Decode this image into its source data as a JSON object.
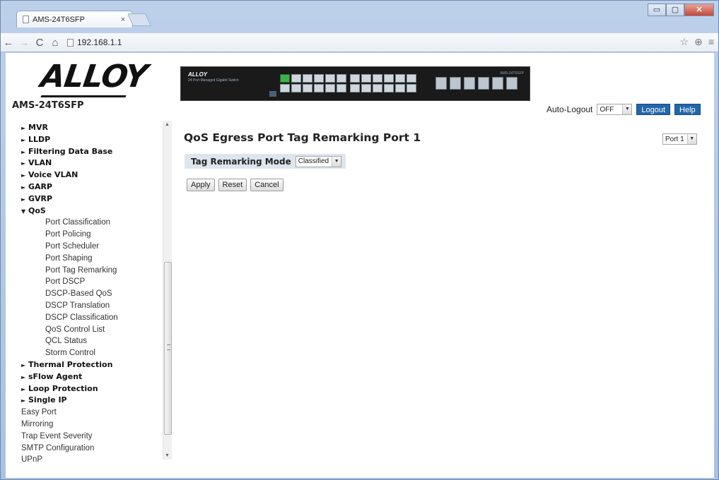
{
  "browser": {
    "tab_title": "AMS-24T6SFP",
    "tab_close": "×",
    "url": "192.168.1.1",
    "back": "←",
    "forward": "→",
    "reload": "C",
    "home": "⌂",
    "star": "☆",
    "ext": "⊕",
    "menu": "≡",
    "minimize": "▭",
    "maximize": "▢",
    "close": "✕"
  },
  "sidebar": {
    "logo": "ALLOY",
    "model": "AMS-24T6SFP",
    "items": [
      {
        "type": "group",
        "arrow": "►",
        "label": "MVR"
      },
      {
        "type": "group",
        "arrow": "►",
        "label": "LLDP"
      },
      {
        "type": "group",
        "arrow": "►",
        "label": "Filtering Data Base"
      },
      {
        "type": "group",
        "arrow": "►",
        "label": "VLAN"
      },
      {
        "type": "group",
        "arrow": "►",
        "label": "Voice VLAN"
      },
      {
        "type": "group",
        "arrow": "►",
        "label": "GARP"
      },
      {
        "type": "group",
        "arrow": "►",
        "label": "GVRP"
      },
      {
        "type": "group",
        "arrow": "▼",
        "label": "QoS"
      },
      {
        "type": "sub",
        "label": "Port Classification"
      },
      {
        "type": "sub",
        "label": "Port Policing"
      },
      {
        "type": "sub",
        "label": "Port Scheduler"
      },
      {
        "type": "sub",
        "label": "Port Shaping"
      },
      {
        "type": "sub",
        "label": "Port Tag Remarking"
      },
      {
        "type": "sub",
        "label": "Port DSCP"
      },
      {
        "type": "sub",
        "label": "DSCP-Based QoS"
      },
      {
        "type": "sub",
        "label": "DSCP Translation"
      },
      {
        "type": "sub",
        "label": "DSCP Classification"
      },
      {
        "type": "sub",
        "label": "QoS Control List"
      },
      {
        "type": "sub",
        "label": "QCL Status"
      },
      {
        "type": "sub",
        "label": "Storm Control"
      },
      {
        "type": "group",
        "arrow": "►",
        "label": "Thermal Protection"
      },
      {
        "type": "group",
        "arrow": "►",
        "label": "sFlow Agent"
      },
      {
        "type": "group",
        "arrow": "►",
        "label": "Loop Protection"
      },
      {
        "type": "group",
        "arrow": "►",
        "label": "Single IP"
      },
      {
        "type": "plain",
        "label": "Easy Port"
      },
      {
        "type": "plain",
        "label": "Mirroring"
      },
      {
        "type": "plain",
        "label": "Trap Event Severity"
      },
      {
        "type": "plain",
        "label": "SMTP Configuration"
      },
      {
        "type": "plain",
        "label": "UPnP"
      }
    ]
  },
  "device": {
    "brand": "ALLOY",
    "brand_sub": "24 Port Managed Gigabit Switch",
    "model": "AMS-24T6SFP"
  },
  "header": {
    "auto_logout_label": "Auto-Logout",
    "auto_logout_value": "OFF",
    "logout_label": "Logout",
    "help_label": "Help"
  },
  "main": {
    "title": "QoS Egress Port Tag Remarking  Port 1",
    "port_select_value": "Port 1",
    "mode_label": "Tag Remarking Mode",
    "mode_value": "Classified",
    "apply_label": "Apply",
    "reset_label": "Reset",
    "cancel_label": "Cancel"
  }
}
